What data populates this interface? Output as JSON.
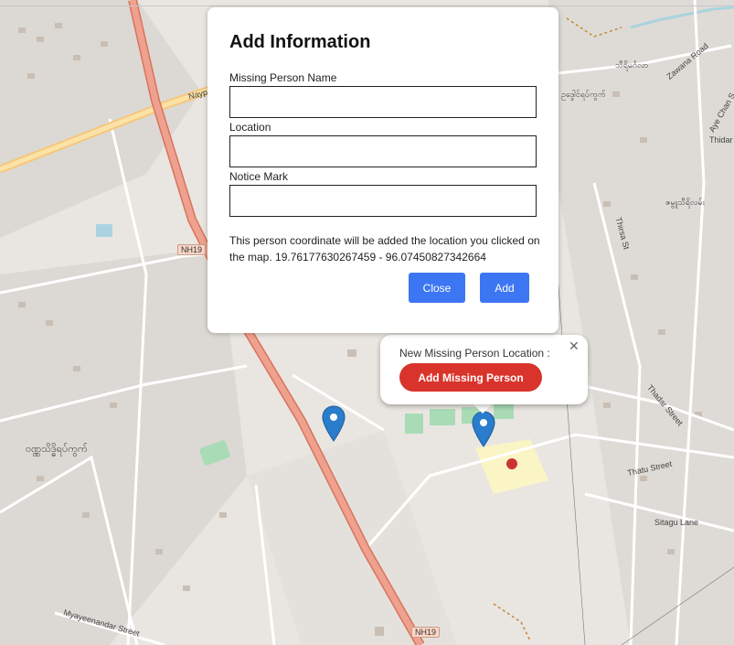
{
  "modal": {
    "title": "Add Information",
    "fields": [
      {
        "label": "Missing Person Name",
        "value": ""
      },
      {
        "label": "Location",
        "value": ""
      },
      {
        "label": "Notice Mark",
        "value": ""
      }
    ],
    "note": "This person coordinate will be added the location you clicked on the map. 19.76177630267459 - 96.07450827342664",
    "close_label": "Close",
    "add_label": "Add",
    "button_color": "#3d76f3"
  },
  "popup": {
    "text": "New Missing Person Location :",
    "close_glyph": "✕",
    "button_label": "Add Missing Person",
    "button_color": "#d9342b"
  },
  "map": {
    "road_labels": {
      "nh19_a": "NH19",
      "nh19_b": "NH19",
      "nayp": "Nayp",
      "zawana": "Zawana Road",
      "aye_chan": "Aye Chan S",
      "thidar": "Thidar",
      "thadar_street": "Thadar Street",
      "thatu_street": "Thatu Street",
      "sitagu_lane": "Sitagu Lane",
      "myayeenandar": "Myayeenandar Street",
      "thirsa": "Thirsa St"
    },
    "place_labels": {
      "burmese_left": "ဝဏ္ဏသိဒ္ဓိရပ်ကွက်",
      "burmese_top": "ဥဒ္ဒေါင်ရပ်ကွက်",
      "burmese_mid": "သီရိမင်္ဂလာ",
      "burmese_right": "ဇမ္ဗူသီရိလမ်း"
    },
    "marker_color": "#2a7dcc",
    "major_road_color": "#e8917e"
  }
}
